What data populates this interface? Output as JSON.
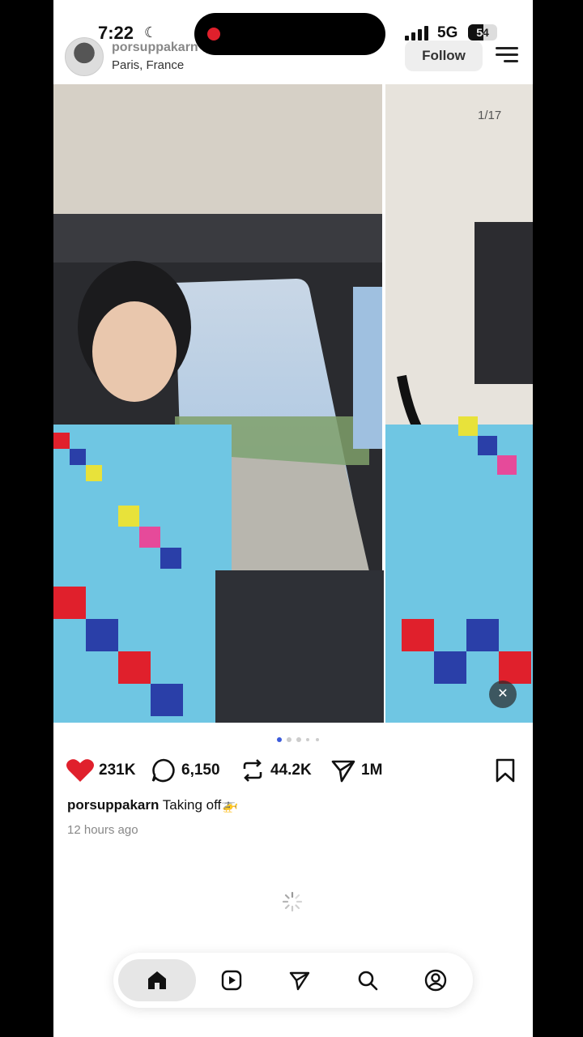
{
  "status_bar": {
    "time": "7:22",
    "network": "5G",
    "battery": "54",
    "battery_level": 0.54,
    "recording_color": "#e0202c"
  },
  "header": {
    "username": "porsuppakarn",
    "location": "Paris, France",
    "follow_label": "Follow",
    "menu_icon": "hamburger-icon"
  },
  "media": {
    "counter": "1/17",
    "mute_icon": "speaker-muted-icon",
    "dots": 5,
    "active_dot": 0
  },
  "actions": {
    "likes": "231K",
    "comments": "6,150",
    "reposts": "44.2K",
    "shares": "1M",
    "like_color": "#e0202c"
  },
  "post": {
    "username": "porsuppakarn",
    "caption": "Taking off🚁",
    "time_ago": "12 hours ago"
  },
  "tabbar": {
    "items": [
      "home-icon",
      "reels-icon",
      "send-icon",
      "search-icon",
      "profile-icon"
    ],
    "active": "home-icon"
  }
}
